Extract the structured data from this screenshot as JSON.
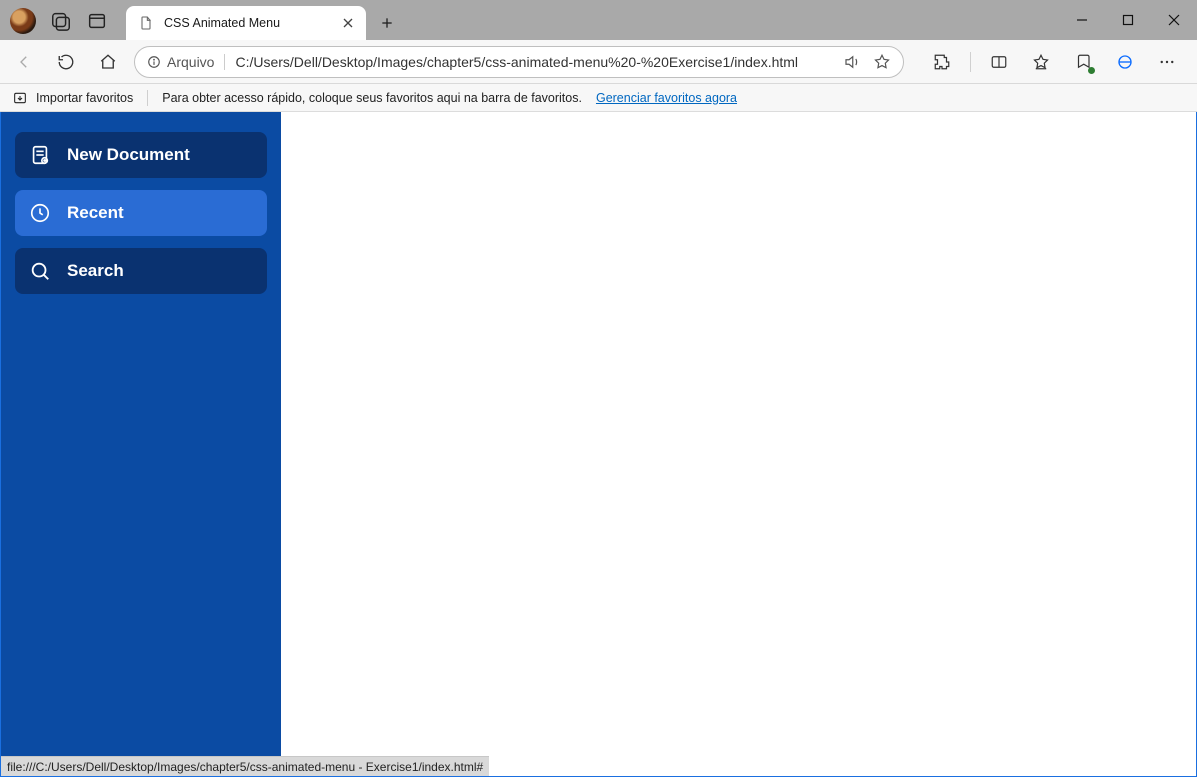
{
  "browser": {
    "tab_title": "CSS Animated Menu",
    "address_scheme_label": "Arquivo",
    "address_url": "C:/Users/Dell/Desktop/Images/chapter5/css-animated-menu%20-%20Exercise1/index.html",
    "bookmarks": {
      "import_label": "Importar favoritos",
      "hint_text": "Para obter acesso rápido, coloque seus favoritos aqui na barra de favoritos.",
      "manage_link": "Gerenciar favoritos agora"
    },
    "status_text": "file:///C:/Users/Dell/Desktop/Images/chapter5/css-animated-menu - Exercise1/index.html#"
  },
  "page": {
    "menu": {
      "items": [
        {
          "label": "New Document",
          "style": "dark",
          "icon": "document-icon"
        },
        {
          "label": "Recent",
          "style": "light",
          "icon": "clock-icon"
        },
        {
          "label": "Search",
          "style": "dark",
          "icon": "search-icon"
        }
      ]
    }
  }
}
